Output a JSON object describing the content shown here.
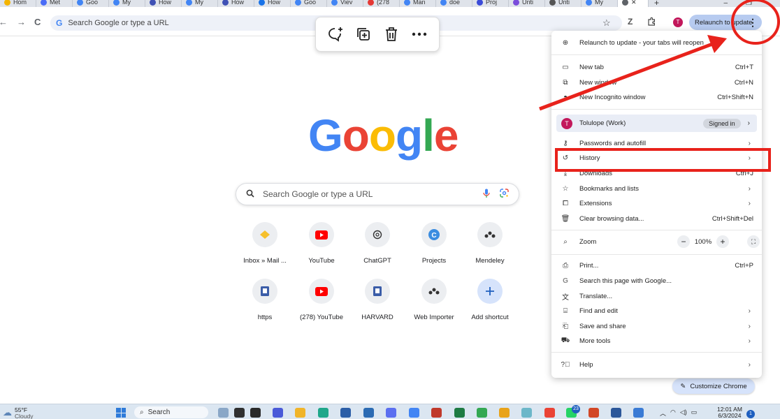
{
  "tabs": [
    {
      "label": "Hom",
      "color": "#f4b400"
    },
    {
      "label": "Met",
      "color": "#4a6cf7"
    },
    {
      "label": "Goo",
      "color": "#4285f4"
    },
    {
      "label": "My",
      "color": "#4285f4"
    },
    {
      "label": "How",
      "color": "#3f51b5"
    },
    {
      "label": "My",
      "color": "#4285f4"
    },
    {
      "label": "How",
      "color": "#3f51b5"
    },
    {
      "label": "How",
      "color": "#1a73e8"
    },
    {
      "label": "Goo",
      "color": "#4285f4"
    },
    {
      "label": "Viev",
      "color": "#4285f4"
    },
    {
      "label": "(278",
      "color": "#e53935"
    },
    {
      "label": "Man",
      "color": "#4285f4"
    },
    {
      "label": "doe",
      "color": "#4285f4"
    },
    {
      "label": "Proj",
      "color": "#3b4bd8"
    },
    {
      "label": "Unti",
      "color": "#7b4ddb"
    },
    {
      "label": "Unti",
      "color": "#555555"
    },
    {
      "label": "My",
      "color": "#4285f4"
    }
  ],
  "active_tab_close": "✕",
  "new_tab_symbol": "+",
  "window_controls": {
    "minimize": "–",
    "restore": "❐"
  },
  "toolbar": {
    "back": "←",
    "forward": "→",
    "reload": "C",
    "omnibox_text": "Search Google or type a URL",
    "profile_initial": "T",
    "relaunch_label": "Relaunch to update",
    "menu_symbol": "⋮"
  },
  "ntp": {
    "search_placeholder": "Search Google or type a URL",
    "shortcuts": [
      {
        "label": "Inbox » Mail ...",
        "icon": "mail-icon"
      },
      {
        "label": "YouTube",
        "icon": "youtube-icon"
      },
      {
        "label": "ChatGPT",
        "icon": "chatgpt-icon"
      },
      {
        "label": "Projects",
        "icon": "projects-icon"
      },
      {
        "label": "Mendeley",
        "icon": "mendeley-icon"
      },
      {
        "label": "https",
        "icon": "book-icon"
      },
      {
        "label": "(278) YouTube",
        "icon": "youtube-icon"
      },
      {
        "label": "HARVARD",
        "icon": "book-icon"
      },
      {
        "label": "Web Importer",
        "icon": "mendeley-icon"
      },
      {
        "label": "Add shortcut",
        "icon": "plus-icon"
      }
    ],
    "customize_label": "Customize Chrome"
  },
  "menu": {
    "relaunch_item": "Relaunch to update - your tabs will reopen",
    "new_tab": {
      "label": "New tab",
      "shortcut": "Ctrl+T"
    },
    "new_window": {
      "label": "New window",
      "shortcut": "Ctrl+N"
    },
    "new_incognito": {
      "label": "New Incognito window",
      "shortcut": "Ctrl+Shift+N"
    },
    "profile": {
      "initial": "T",
      "name": "Tolulope (Work)",
      "status": "Signed in"
    },
    "passwords": "Passwords and autofill",
    "history": "History",
    "downloads": {
      "label": "Downloads",
      "shortcut": "Ctrl+J"
    },
    "bookmarks": "Bookmarks and lists",
    "extensions": "Extensions",
    "clear_data": {
      "label": "Clear browsing data...",
      "shortcut": "Ctrl+Shift+Del"
    },
    "zoom": {
      "label": "Zoom",
      "minus": "−",
      "value": "100%",
      "plus": "+"
    },
    "print": {
      "label": "Print...",
      "shortcut": "Ctrl+P"
    },
    "search_page": "Search this page with Google...",
    "translate": "Translate...",
    "find_edit": "Find and edit",
    "save_share": "Save and share",
    "more_tools": "More tools",
    "help": "Help",
    "arrow": "›"
  },
  "taskbar": {
    "temp": "55°F",
    "condition": "Cloudy",
    "search_label": "Search",
    "time": "12:01 AM",
    "date": "6/3/2024",
    "notifications": "1",
    "badge_23": "23"
  },
  "colors": {
    "google_blue": "#4285f4",
    "google_red": "#ea4335",
    "google_yellow": "#fbbc05",
    "google_green": "#34a853",
    "annotation_red": "#e8221b"
  }
}
